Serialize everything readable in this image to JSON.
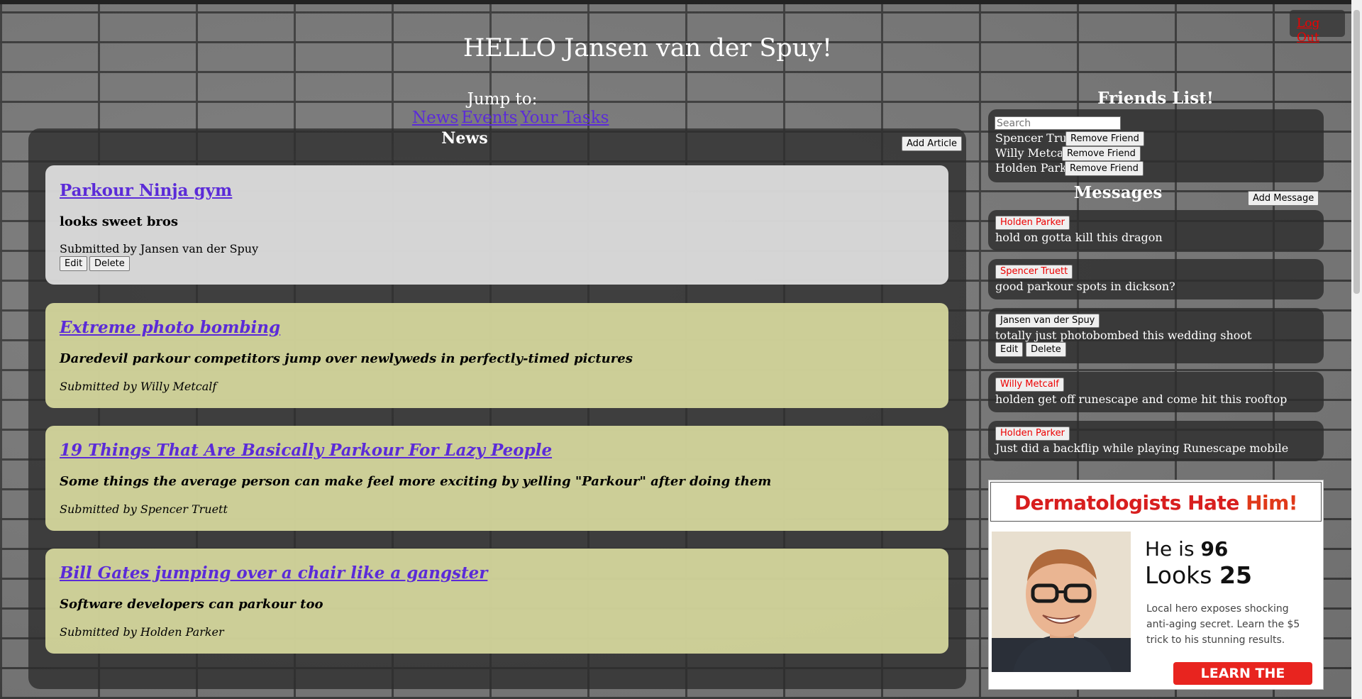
{
  "header": {
    "greeting": "HELLO Jansen van der Spuy!",
    "logout_label": "Log Out"
  },
  "jump": {
    "label": "Jump to:",
    "links": [
      "News",
      "Events",
      "Your Tasks"
    ]
  },
  "news": {
    "title": "News",
    "add_label": "Add Article",
    "edit_label": "Edit",
    "delete_label": "Delete",
    "articles": [
      {
        "title": "Parkour Ninja gym",
        "summary": "looks sweet bros",
        "byline": "Submitted by Jansen van der Spuy"
      },
      {
        "title": "Extreme photo bombing",
        "summary": "Daredevil parkour competitors jump over newlyweds in perfectly-timed pictures",
        "byline": "Submitted by Willy Metcalf"
      },
      {
        "title": "19 Things That Are Basically Parkour For Lazy People",
        "summary": "Some things the average person can make feel more exciting by yelling \"Parkour\" after doing them",
        "byline": "Submitted by Spencer Truett"
      },
      {
        "title": "Bill Gates jumping over a chair like a gangster",
        "summary": "Software developers can parkour too",
        "byline": "Submitted by Holden Parker"
      }
    ]
  },
  "friends": {
    "title": "Friends List!",
    "search_placeholder": "Search",
    "remove_label": "Remove Friend",
    "items": [
      "Spencer Truett",
      "Willy Metcalf",
      "Holden Parker"
    ]
  },
  "messages": {
    "title": "Messages",
    "add_label": "Add Message",
    "edit_label": "Edit",
    "delete_label": "Delete",
    "items": [
      {
        "author": "Holden Parker",
        "text": "hold on gotta kill this dragon"
      },
      {
        "author": "Spencer Truett",
        "text": "good parkour spots in dickson?"
      },
      {
        "author": "Jansen van der Spuy",
        "text": "totally just photobombed this wedding shoot"
      },
      {
        "author": "Willy Metcalf",
        "text": "holden get off runescape and come hit this rooftop"
      },
      {
        "author": "Holden Parker",
        "text": "Just did a backflip while playing Runescape mobile"
      }
    ]
  },
  "ad": {
    "headline_a": "Dermatologists Hate ",
    "headline_b": "Him!",
    "line1_a": "He is ",
    "line1_b": "96",
    "line2_a": "Looks ",
    "line2_b": "25",
    "copy": "Local  hero exposes shocking anti-aging secret. Learn the $5 trick to his stunning results.",
    "cta": "LEARN THE TRUTH NOW"
  },
  "colors": {
    "link": "#5b2bd8",
    "alert_red": "#e00000",
    "own_card": "#e6e6e6",
    "other_card": "#d8da9e"
  }
}
